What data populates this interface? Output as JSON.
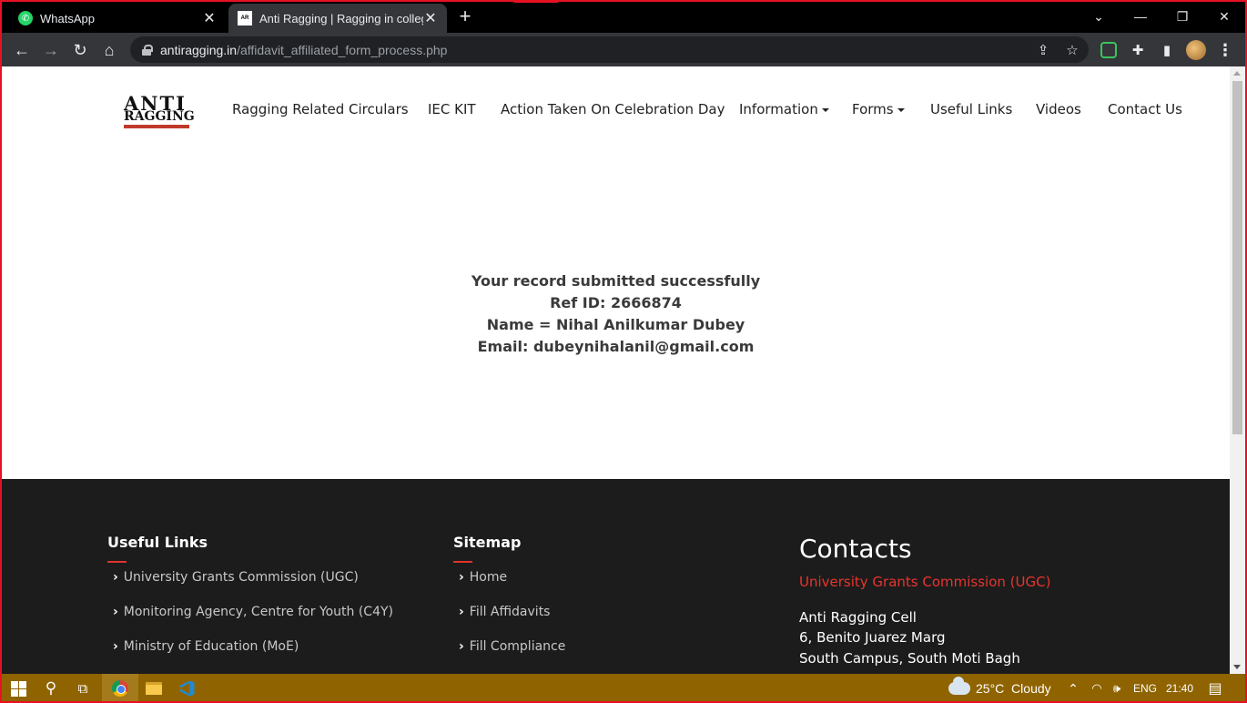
{
  "browser": {
    "tabs": [
      {
        "title": "WhatsApp",
        "active": false
      },
      {
        "title": "Anti Ragging | Ragging in college",
        "active": true
      }
    ],
    "url_host": "antiragging.in",
    "url_path": "/affidavit_affiliated_form_process.php",
    "window_controls": [
      "chevron-down-icon",
      "minimize-icon",
      "restore-icon",
      "close-icon"
    ],
    "toolbar_icons": [
      "back-icon",
      "forward-icon",
      "reload-icon",
      "home-icon",
      "share-icon",
      "star-icon",
      "extension-icon",
      "puzzle-icon",
      "sidepanel-icon",
      "profile-avatar",
      "menu-icon"
    ]
  },
  "site": {
    "logo_top": "ANTI",
    "logo_bottom": "RAGGING",
    "nav": [
      {
        "label": "Ragging Related Circulars",
        "dropdown": false
      },
      {
        "label": "IEC KIT",
        "dropdown": false
      },
      {
        "label": "Action Taken On Celebration Day",
        "dropdown": false
      },
      {
        "label": "Information",
        "dropdown": true
      },
      {
        "label": "Forms",
        "dropdown": true
      },
      {
        "label": "Useful Links",
        "dropdown": false
      },
      {
        "label": "Videos",
        "dropdown": false
      },
      {
        "label": "Contact Us",
        "dropdown": false
      }
    ]
  },
  "message": {
    "line1": "Your record submitted successfully",
    "line2": "Ref ID: 2666874",
    "line3": "Name = Nihal Anilkumar Dubey",
    "line4": "Email: dubeynihalanil@gmail.com"
  },
  "footer": {
    "useful_links_title": "Useful Links",
    "useful_links": [
      "University Grants Commission (UGC)",
      "Monitoring Agency, Centre for Youth (C4Y)",
      "Ministry of Education (MoE)"
    ],
    "sitemap_title": "Sitemap",
    "sitemap": [
      "Home",
      "Fill Affidavits",
      "Fill Compliance"
    ],
    "contacts_title": "Contacts",
    "contacts_org": "University Grants Commission (UGC)",
    "contacts_address": [
      "Anti Ragging Cell",
      "6, Benito Juarez Marg",
      "South Campus, South Moti Bagh"
    ]
  },
  "taskbar": {
    "weather": "25°C  Cloudy",
    "language": "ENG",
    "time": "21:40",
    "accent_color": "#8f6400"
  }
}
